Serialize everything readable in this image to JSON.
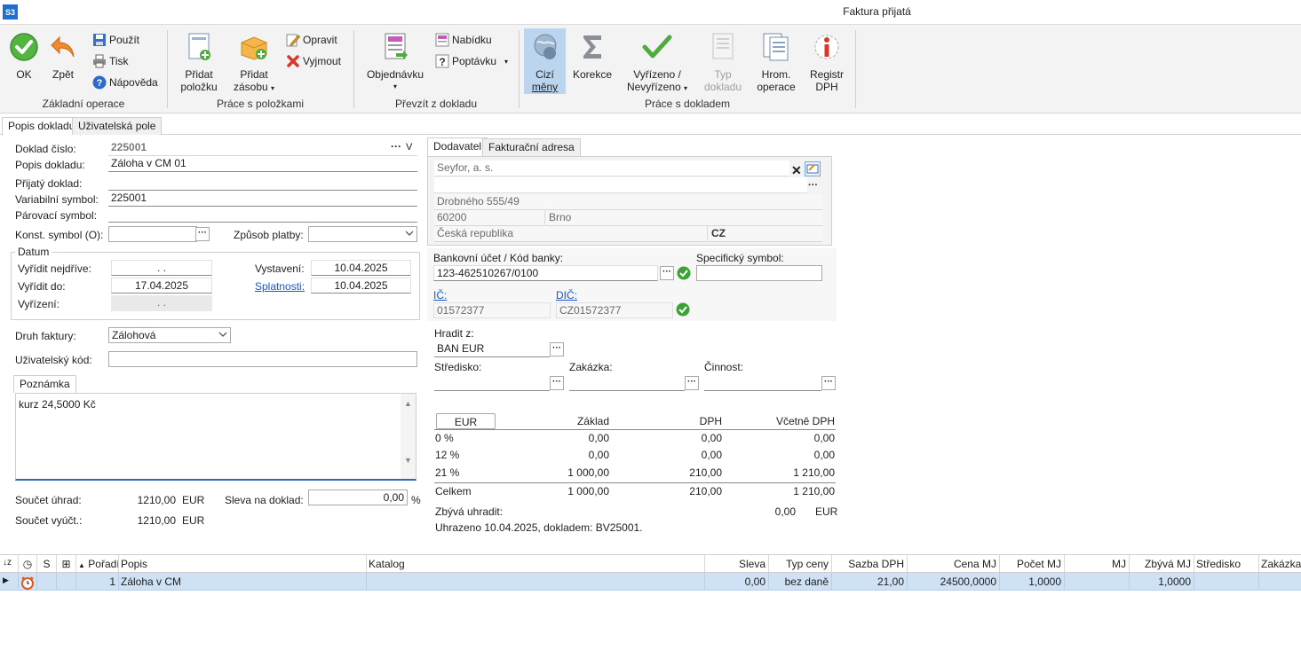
{
  "window": {
    "app_badge": "S3",
    "title": "Faktura přijatá"
  },
  "ribbon": {
    "ok": "OK",
    "back": "Zpět",
    "use": "Použít",
    "print": "Tisk",
    "help": "Nápověda",
    "group_basic": "Základní operace",
    "add_item_1": "Přidat",
    "add_item_2": "položku",
    "add_stock_1": "Přidat",
    "add_stock_2": "zásobu",
    "edit": "Opravit",
    "cut": "Vyjmout",
    "group_items": "Práce s položkami",
    "order": "Objednávku",
    "offer": "Nabídku",
    "inquiry": "Poptávku",
    "group_take": "Převzít z dokladu",
    "foreign_1": "Cizí",
    "foreign_2": "měny",
    "correction": "Korekce",
    "done_1": "Vyřízeno /",
    "done_2": "Nevyřízeno",
    "doctype_1": "Typ",
    "doctype_2": "dokladu",
    "bulk_1": "Hrom.",
    "bulk_2": "operace",
    "vat_1": "Registr",
    "vat_2": "DPH",
    "group_doc": "Práce s dokladem"
  },
  "tabs": {
    "description": "Popis dokladu",
    "user_fields": "Uživatelská pole"
  },
  "form": {
    "doc_no_label": "Doklad číslo:",
    "doc_no": "225001",
    "doc_desc_label": "Popis dokladu:",
    "doc_desc": "Záloha v CM 01",
    "received_label": "Přijatý doklad:",
    "received": "",
    "var_symbol_label": "Variabilní symbol:",
    "var_symbol": "225001",
    "pair_symbol_label": "Párovací symbol:",
    "pair_symbol": "",
    "const_symbol_label": "Konst. symbol (O):",
    "const_symbol": "",
    "payment_label": "Způsob platby:",
    "payment": "",
    "dates_title": "Datum",
    "resolve_first_label": "Vyřídit nejdříve:",
    "resolve_first": ".   .",
    "resolve_by_label": "Vyřídit do:",
    "resolve_by": "17.04.2025",
    "resolved_label": "Vyřízení:",
    "resolved": ".   .",
    "issued_label": "Vystavení:",
    "issued": "10.04.2025",
    "due_label": "Splatnosti:",
    "due": "10.04.2025",
    "invoice_type_label": "Druh faktury:",
    "invoice_type": "Zálohová",
    "user_code_label": "Uživatelský kód:",
    "user_code": "",
    "note_tab": "Poznámka",
    "note": "kurz 24,5000 Kč",
    "total_payment_label": "Součet úhrad:",
    "total_payment": "1210,00",
    "total_payment_cur": "EUR",
    "total_billing_label": "Součet vyúčt.:",
    "total_billing": "1210,00",
    "total_billing_cur": "EUR",
    "discount_label": "Sleva na doklad:",
    "discount": "0,00",
    "discount_unit": "%"
  },
  "supplier": {
    "tab_supplier": "Dodavatel",
    "tab_billing": "Fakturační adresa",
    "name": "Seyfor, a. s.",
    "line2": "",
    "street": "Drobného 555/49",
    "zip": "60200",
    "city": "Brno",
    "country": "Česká republika",
    "country_code": "CZ"
  },
  "bank": {
    "account_label": "Bankovní účet / Kód banky:",
    "account": "123-462510267/0100",
    "specific_label": "Specifický symbol:",
    "specific": "",
    "ic_label": "IČ:",
    "ic": "01572377",
    "dic_label": "DIČ:",
    "dic": "CZ01572377",
    "pay_from_label": "Hradit z:",
    "pay_from": "BAN EUR",
    "center_label": "Středisko:",
    "center": "",
    "contract_label": "Zakázka:",
    "contract": "",
    "activity_label": "Činnost:",
    "activity": ""
  },
  "vat_table": {
    "currency": "EUR",
    "headers": [
      "Základ",
      "DPH",
      "Včetně DPH"
    ],
    "rows": [
      {
        "rate": "0 %",
        "base": "0,00",
        "vat": "0,00",
        "total": "0,00"
      },
      {
        "rate": "12 %",
        "base": "0,00",
        "vat": "0,00",
        "total": "0,00"
      },
      {
        "rate": "21 %",
        "base": "1 000,00",
        "vat": "210,00",
        "total": "1 210,00"
      }
    ],
    "sum": {
      "label": "Celkem",
      "base": "1 000,00",
      "vat": "210,00",
      "total": "1 210,00"
    },
    "remaining_label": "Zbývá uhradit:",
    "remaining": "0,00",
    "remaining_cur": "EUR",
    "paid_note": "Uhrazeno 10.04.2025, dokladem: BV25001."
  },
  "grid": {
    "headers": {
      "s": "S",
      "order": "Pořadí",
      "desc": "Popis",
      "catalog": "Katalog",
      "discount": "Sleva",
      "price_type": "Typ ceny",
      "vat_rate": "Sazba DPH",
      "unit_price": "Cena MJ",
      "qty": "Počet MJ",
      "unit": "MJ",
      "remaining": "Zbývá MJ",
      "center": "Středisko",
      "contract": "Zakázka"
    },
    "rows": [
      {
        "order": "1",
        "desc": "Záloha v CM",
        "catalog": "",
        "discount": "0,00",
        "price_type": "bez daně",
        "vat_rate": "21,00",
        "unit_price": "24500,0000",
        "qty": "1,0000",
        "unit": "",
        "remaining": "1,0000",
        "center": "",
        "contract": ""
      }
    ]
  }
}
